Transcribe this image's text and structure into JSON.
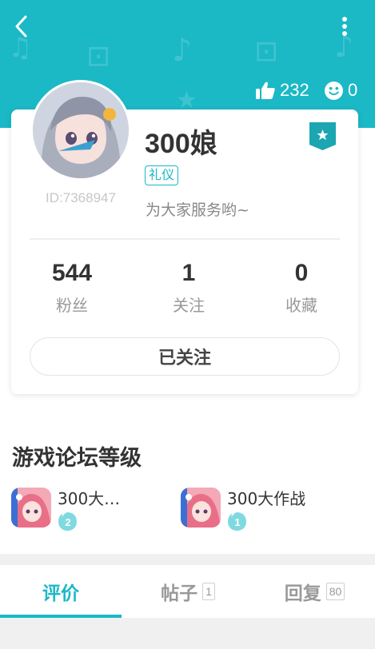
{
  "header": {
    "likes_count": "232",
    "smiles_count": "0",
    "icons": {
      "back": "back-arrow-icon",
      "more": "more-vertical-icon",
      "likes": "thumbs-up-icon",
      "smiles": "smiley-icon"
    },
    "accent_color": "#1bb8c6"
  },
  "profile": {
    "name": "300娘",
    "badge": "礼仪",
    "user_id": "ID:7368947",
    "bio": "为大家服务哟~",
    "stats": [
      {
        "value": "544",
        "label": "粉丝"
      },
      {
        "value": "1",
        "label": "关注"
      },
      {
        "value": "0",
        "label": "收藏"
      }
    ],
    "follow_label": "已关注"
  },
  "game_levels": {
    "title": "游戏论坛等级",
    "games": [
      {
        "name": "300大…",
        "level": "2"
      },
      {
        "name": "300大作战",
        "level": "1"
      }
    ]
  },
  "tabs": [
    {
      "label": "评价",
      "count": "",
      "active": true
    },
    {
      "label": "帖子",
      "count": "1",
      "active": false
    },
    {
      "label": "回复",
      "count": "80",
      "active": false
    }
  ]
}
